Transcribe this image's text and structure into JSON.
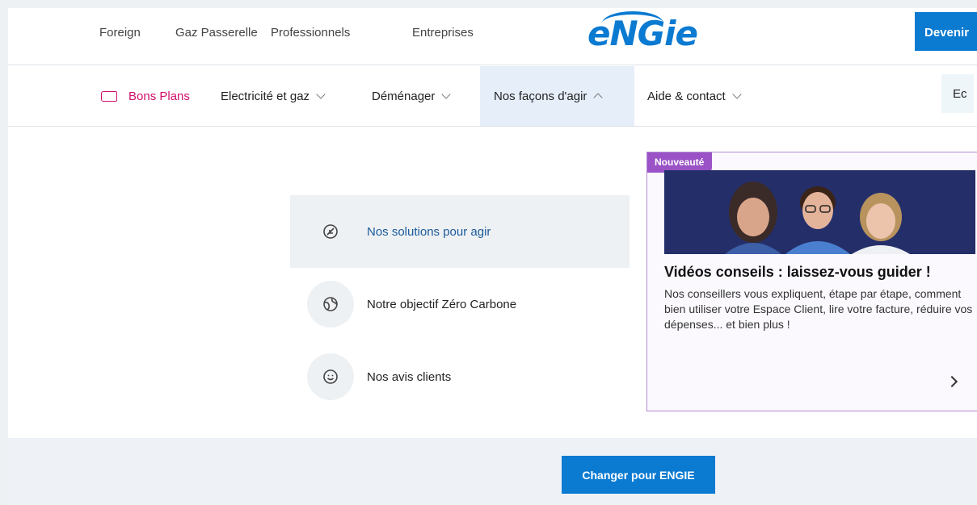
{
  "topbar": {
    "links": [
      "Foreign",
      "Gaz Passerelle",
      "Professionnels",
      "Entreprises"
    ],
    "logo": "eNGie",
    "cta": "Devenir"
  },
  "nav": {
    "bons_plans": "Bons Plans",
    "items": [
      {
        "label": "Electricité et gaz",
        "state": "collapsed"
      },
      {
        "label": "Déménager",
        "state": "collapsed"
      },
      {
        "label": "Nos façons d'agir",
        "state": "expanded"
      },
      {
        "label": "Aide & contact",
        "state": "collapsed"
      }
    ],
    "right_partial": "Ec"
  },
  "menu": {
    "items": [
      {
        "label": "Nos solutions pour agir",
        "icon": "leaf-icon",
        "active": true
      },
      {
        "label": "Notre objectif Zéro Carbone",
        "icon": "globe-icon",
        "active": false
      },
      {
        "label": "Nos avis clients",
        "icon": "smiley-icon",
        "active": false
      }
    ]
  },
  "promo": {
    "badge": "Nouveauté",
    "title": "Vidéos conseils : laissez-vous guider !",
    "text": "Nos conseillers vous expliquent, étape par étape, comment bien utiliser votre Espace Client, lire votre facture, réduire vos dépenses... et bien plus !"
  },
  "footer_cta": "Changer pour ENGIE",
  "colors": {
    "brand_blue": "#0b7ad1",
    "bons_plans_pink": "#d0106b",
    "badge_purple": "#9a52c6",
    "active_nav_bg": "#e6eef9"
  }
}
